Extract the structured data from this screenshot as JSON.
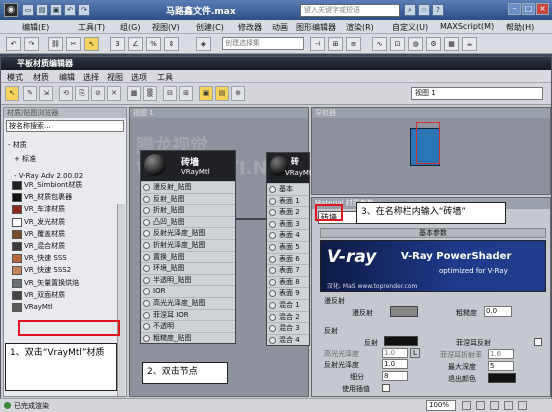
{
  "app": {
    "logo": "3ds Max",
    "title": "马路鑫文件.max",
    "search_placeholder": "键入关键字或短语"
  },
  "menu": [
    "编辑(E)",
    "工具(T)",
    "组(G)",
    "视图(V)",
    "创建(C)",
    "修改器",
    "动画",
    "图形编辑器",
    "渲染(R)",
    "自定义(U)",
    "MAXScript(M)",
    "帮助(H)"
  ],
  "toolbar": {
    "selection_set": "创建选择集",
    "icons": [
      "undo-icon",
      "redo-icon",
      "link-icon",
      "unlink-icon",
      "bind-icon",
      "select-icon",
      "snap-3-icon",
      "angle-snap-icon",
      "percent-snap-icon",
      "spinner-snap-icon",
      "named-set-icon",
      "mirror-icon",
      "align-icon",
      "layer-icon",
      "curve-icon",
      "schematic-icon",
      "material-icon",
      "render-setup-icon",
      "render-frame-icon",
      "render-icon"
    ]
  },
  "material_editor": {
    "title": "平板材质编辑器",
    "menu": [
      "模式",
      "材质",
      "编辑",
      "选择",
      "视图",
      "选项",
      "工具"
    ],
    "view_select": "视图 1"
  },
  "browser": {
    "header": "材质/贴图浏览器",
    "search_placeholder": "按名称搜索...",
    "section_materials": "- 材质",
    "section_standard": "+ 标准",
    "section_vray": "- V-Ray Adv 2.00.02",
    "items": [
      {
        "label": "VR_Simbiont材质",
        "color": "#222222"
      },
      {
        "label": "VR_材质包裹器",
        "color": "#111111"
      },
      {
        "label": "VR_车漆材质",
        "color": "#8a2a1f"
      },
      {
        "label": "VR_发光材质",
        "color": "#ffffff"
      },
      {
        "label": "VR_覆盖材质",
        "color": "#7a4a2a"
      },
      {
        "label": "VR_混合材质",
        "color": "#3a3a3a"
      },
      {
        "label": "VR_快速 SSS",
        "color": "#b86a3a"
      },
      {
        "label": "VR_快速 SSS2",
        "color": "#c8845a"
      },
      {
        "label": "VR_矢量置换烘焙",
        "color": "#6b6e74"
      },
      {
        "label": "VR_双面材质",
        "color": "#444444"
      },
      {
        "label": "VRayMtl",
        "color": "#5a5a5a"
      }
    ]
  },
  "node_view": {
    "header": "视图 1",
    "node1": {
      "title": "砖墙",
      "subtitle": "VRayMtl",
      "rows": [
        "漫反射_贴图",
        "反射_贴图",
        "折射_贴图",
        "凸凹_贴图",
        "反射光泽度_贴图",
        "折射光泽度_贴图",
        "置换_贴图",
        "环境_贴图",
        "半透明_贴图",
        "IOR",
        "高光光泽度_贴图",
        "菲涅耳 IOR",
        "不透明",
        "粗糙度_贴图"
      ]
    },
    "node2": {
      "title": "砖",
      "subtitle": "VRayMtl",
      "rows": [
        "基本",
        "表面 1",
        "表面 2",
        "表面 3",
        "表面 4",
        "表面 5",
        "表面 6",
        "表面 7",
        "表面 8",
        "表面 9",
        "混合 1",
        "混合 2",
        "混合 3",
        "混合 4"
      ]
    }
  },
  "navigator": {
    "header": "导航器"
  },
  "params": {
    "header": "Material 材质参数",
    "name_value": "砖墙",
    "rollout_title": "基本参数",
    "banner_logo": "V-ray",
    "banner_title": "V-Ray PowerShader",
    "banner_subtitle": "optimized for V-Ray",
    "banner_credit": "汉化: MaS  www.toprender.com",
    "diffuse_group": "漫反射",
    "diffuse_label": "漫反射",
    "roughness_label": "粗糙度",
    "roughness_value": "0.0",
    "reflection_group": "反射",
    "reflect_label": "反射",
    "hilight_gloss_label": "高光光泽度",
    "hilight_gloss_value": "1.0",
    "l_button": "L",
    "fresnel_label": "菲涅耳反射",
    "refl_gloss_label": "反射光泽度",
    "refl_gloss_value": "1.0",
    "fresnel_ior_label": "菲涅耳折射率",
    "fresnel_ior_value": "1.6",
    "subdivs_label": "细分",
    "subdivs_value": "8",
    "max_depth_label": "最大深度",
    "max_depth_value": "5",
    "use_interp_label": "使用插值",
    "exit_color_label": "退出颜色"
  },
  "status": {
    "text": "已完成渲染",
    "zoom": "100%"
  },
  "watermark": "腾龙视觉  WWW.TTYI.NET",
  "callouts": {
    "step1": "1、双击“VrayMtl”材质",
    "step2": "2、双击节点",
    "step3": "3、在名称栏内输入“砖墙”"
  }
}
